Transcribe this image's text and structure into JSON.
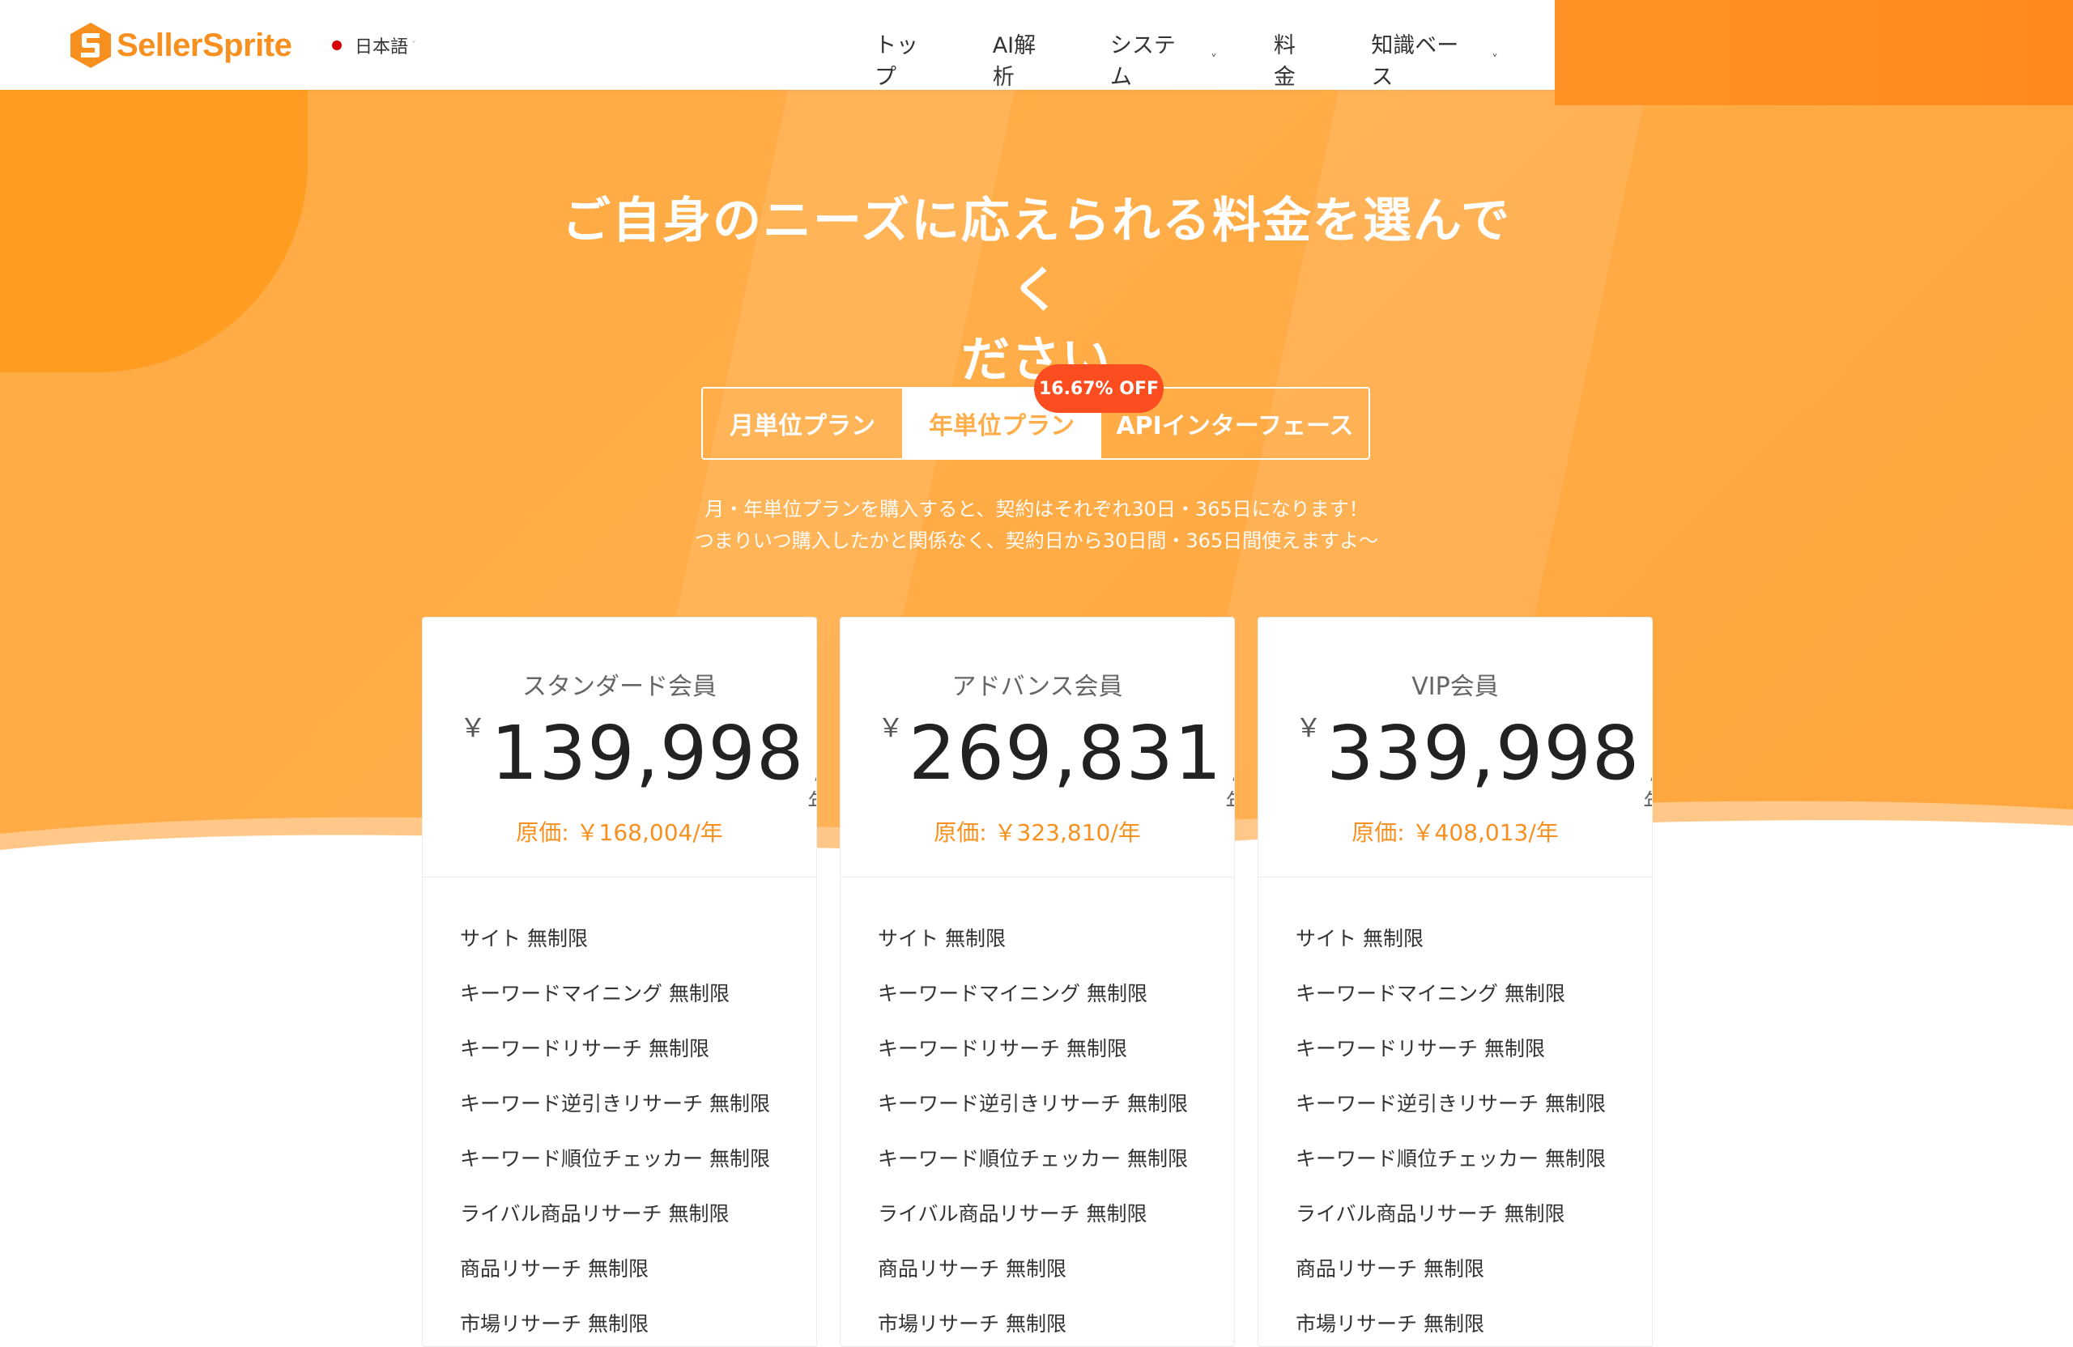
{
  "brand": {
    "name": "SellerSprite",
    "accent": "#f7901e"
  },
  "language": {
    "label": "日本語"
  },
  "nav": {
    "items": [
      {
        "label": "トップ",
        "dropdown": false
      },
      {
        "label": "AI解析",
        "dropdown": false
      },
      {
        "label": "システム",
        "dropdown": true
      },
      {
        "label": "料金",
        "dropdown": false
      },
      {
        "label": "知識ベース",
        "dropdown": true
      }
    ]
  },
  "hero": {
    "title_line1": "ご自身のニーズに応えられる料金を選んでく",
    "title_line2": "ださい",
    "tabs": [
      {
        "label": "月単位プラン",
        "active": false
      },
      {
        "label": "年単位プラン",
        "active": true
      },
      {
        "label": "APIインターフェース",
        "active": false
      }
    ],
    "badge": "16.67% OFF",
    "note_line1": "月・年単位プランを購入すると、契約はそれぞれ30日・365日になります！",
    "note_line2": "つまりいつ購入したかと関係なく、契約日から30日間・365日間使えますよ～"
  },
  "plans": [
    {
      "name": "スタンダード会員",
      "currency": "￥",
      "price": "139,998",
      "period": "/年",
      "original": "原価: ￥168,004/年",
      "features": [
        "サイト 無制限",
        "キーワードマイニング 無制限",
        "キーワードリサーチ 無制限",
        "キーワード逆引きリサーチ 無制限",
        "キーワード順位チェッカー 無制限",
        "ライバル商品リサーチ 無制限",
        "商品リサーチ 無制限",
        "市場リサーチ 無制限"
      ]
    },
    {
      "name": "アドバンス会員",
      "currency": "￥",
      "price": "269,831",
      "period": "/年",
      "original": "原価: ￥323,810/年",
      "features": [
        "サイト 無制限",
        "キーワードマイニング 無制限",
        "キーワードリサーチ 無制限",
        "キーワード逆引きリサーチ 無制限",
        "キーワード順位チェッカー 無制限",
        "ライバル商品リサーチ 無制限",
        "商品リサーチ 無制限",
        "市場リサーチ 無制限"
      ]
    },
    {
      "name": "VIP会員",
      "currency": "￥",
      "price": "339,998",
      "period": "/年",
      "original": "原価: ￥408,013/年",
      "features": [
        "サイト 無制限",
        "キーワードマイニング 無制限",
        "キーワードリサーチ 無制限",
        "キーワード逆引きリサーチ 無制限",
        "キーワード順位チェッカー 無制限",
        "ライバル商品リサーチ 無制限",
        "商品リサーチ 無制限",
        "市場リサーチ 無制限"
      ]
    }
  ]
}
